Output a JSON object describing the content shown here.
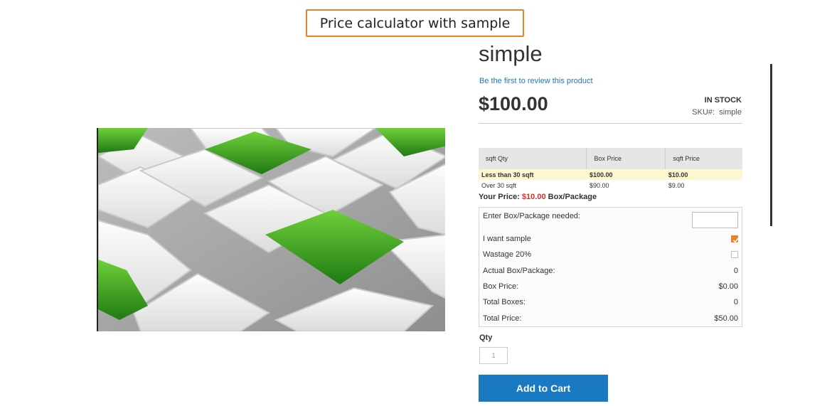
{
  "banner": {
    "label": "Price calculator with sample"
  },
  "product": {
    "title": "simple",
    "review_link": "Be the first to review this product",
    "price": "$100.00",
    "stock": "IN STOCK",
    "sku_label": "SKU#:",
    "sku_value": "simple"
  },
  "tier_table": {
    "headers": [
      "sqft Qty",
      "Box Price",
      "sqft Price"
    ],
    "rows": [
      {
        "qty": "Less than 30 sqft",
        "box_price": "$100.00",
        "sqft_price": "$10.00"
      },
      {
        "qty": "Over 30 sqft",
        "box_price": "$90.00",
        "sqft_price": "$9.00"
      }
    ]
  },
  "your_price": {
    "label": "Your Price:",
    "value": "$10.00",
    "unit": "Box/Package"
  },
  "calculator": {
    "box_needed_label": "Enter Box/Package needed:",
    "box_needed_value": "",
    "sample_label": "I want sample",
    "sample_checked": true,
    "wastage_label": "Wastage 20%",
    "wastage_checked": false,
    "actual_label": "Actual Box/Package:",
    "actual_value": "0",
    "box_price_label": "Box Price:",
    "box_price_value": "$0.00",
    "total_boxes_label": "Total Boxes:",
    "total_boxes_value": "0",
    "total_price_label": "Total Price:",
    "total_price_value": "$50.00"
  },
  "qty": {
    "label": "Qty",
    "value": "1"
  },
  "cart": {
    "button_label": "Add to Cart"
  },
  "colors": {
    "accent": "#1979c3",
    "banner_border": "#e8822a",
    "price_red": "#e02b27",
    "highlight_row": "#fdf6cf"
  }
}
